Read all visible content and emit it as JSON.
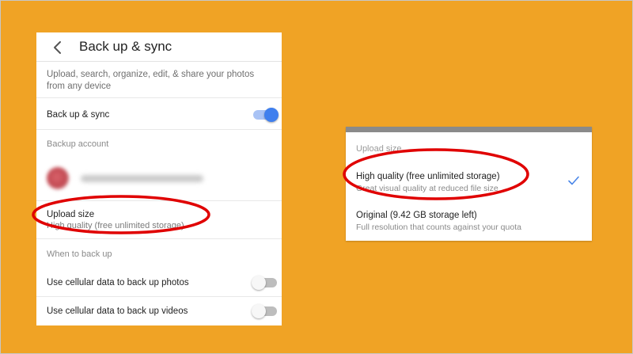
{
  "settings": {
    "title": "Back up & sync",
    "description": "Upload, search, organize, edit, & share your photos from any device",
    "backup_sync_label": "Back up & sync",
    "backup_sync_on": true,
    "backup_account_label": "Backup account",
    "upload_size_label": "Upload size",
    "upload_size_value": "High quality (free unlimited storage)",
    "when_to_back_up_label": "When to back up",
    "cellular_photos_label": "Use cellular data to back up photos",
    "cellular_photos_on": false,
    "cellular_videos_label": "Use cellular data to back up videos",
    "cellular_videos_on": false
  },
  "dialog": {
    "header": "Upload size",
    "options": [
      {
        "title": "High quality (free unlimited storage)",
        "subtitle": "Great visual quality at reduced file size",
        "selected": true
      },
      {
        "title": "Original (9.42 GB storage left)",
        "subtitle": "Full resolution that counts against your quota",
        "selected": false
      }
    ]
  },
  "colors": {
    "background": "#f0a325",
    "toggle_on": "#3f7fee",
    "checkmark": "#4a86e8",
    "highlight_oval": "#e00000"
  },
  "icons": {
    "back": "back-arrow-icon",
    "check": "checkmark-icon"
  }
}
